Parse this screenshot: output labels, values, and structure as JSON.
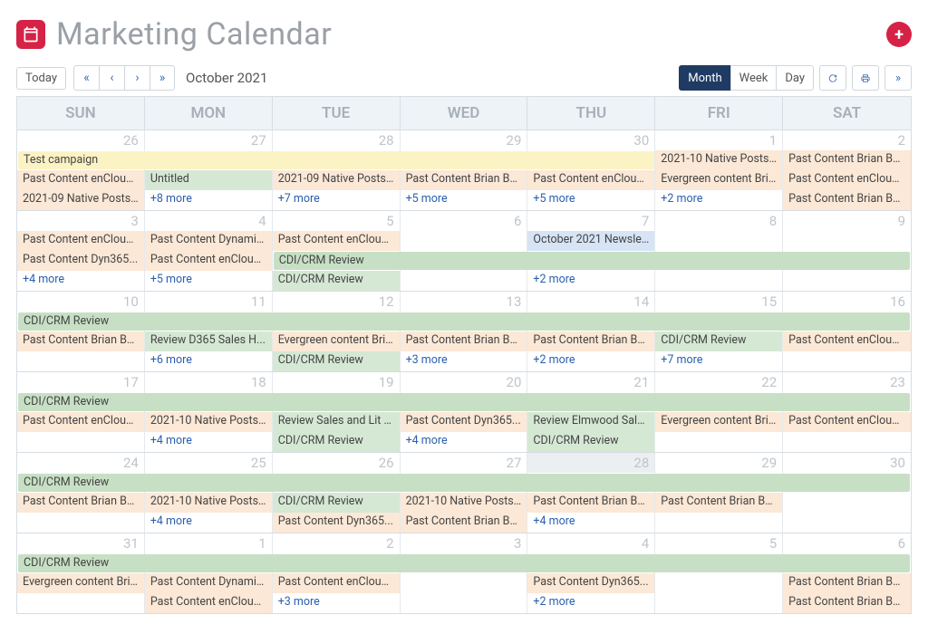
{
  "header": {
    "title": "Marketing Calendar"
  },
  "toolbar": {
    "today": "Today",
    "current_month": "October 2021",
    "views": {
      "month": "Month",
      "week": "Week",
      "day": "Day",
      "active": "month"
    }
  },
  "day_headers": [
    "SUN",
    "MON",
    "TUE",
    "WED",
    "THU",
    "FRI",
    "SAT"
  ],
  "weeks": [
    {
      "dates": [
        {
          "n": "26"
        },
        {
          "n": "27"
        },
        {
          "n": "28"
        },
        {
          "n": "29"
        },
        {
          "n": "30"
        },
        {
          "n": "1"
        },
        {
          "n": "2"
        }
      ],
      "spans": [
        {
          "row": 0,
          "start": 0,
          "end": 4,
          "cls": "c-yellow",
          "label": "Test campaign"
        }
      ],
      "cells": [
        [
          null,
          null,
          null,
          null,
          null,
          {
            "cls": "c-orange",
            "label": "2021-10 Native Posts ..."
          },
          {
            "cls": "c-orange",
            "label": "Past Content Brian Be..."
          }
        ],
        [
          {
            "cls": "c-orange",
            "label": "Past Content enCloud..."
          },
          {
            "cls": "c-green",
            "label": "Untitled"
          },
          {
            "cls": "c-orange",
            "label": "2021-09 Native Posts ..."
          },
          {
            "cls": "c-orange",
            "label": "Past Content Brian Be..."
          },
          {
            "cls": "c-orange",
            "label": "Past Content enCloud..."
          },
          {
            "cls": "c-orange",
            "label": "Evergreen content Bri..."
          },
          {
            "cls": "c-orange",
            "label": "Past Content enCloud..."
          }
        ],
        [
          {
            "cls": "c-orange",
            "label": "2021-09 Native Posts ..."
          },
          {
            "cls": "more",
            "label": "+8 more"
          },
          {
            "cls": "more",
            "label": "+7 more"
          },
          {
            "cls": "more",
            "label": "+5 more"
          },
          {
            "cls": "more",
            "label": "+5 more"
          },
          {
            "cls": "more",
            "label": "+2 more"
          },
          {
            "cls": "c-orange",
            "label": "Past Content Brian Be..."
          }
        ]
      ]
    },
    {
      "dates": [
        {
          "n": "3"
        },
        {
          "n": "4"
        },
        {
          "n": "5"
        },
        {
          "n": "6"
        },
        {
          "n": "7"
        },
        {
          "n": "8"
        },
        {
          "n": "9"
        }
      ],
      "spans": [
        {
          "row": 1,
          "start": 2,
          "end": 6,
          "cls": "c-greenb",
          "label": "CDI/CRM Review"
        }
      ],
      "cells": [
        [
          {
            "cls": "c-orange",
            "label": "Past Content enCloud..."
          },
          {
            "cls": "c-orange",
            "label": "Past Content Dynamic..."
          },
          {
            "cls": "c-orange",
            "label": "Past Content enCloud..."
          },
          null,
          {
            "cls": "c-blue",
            "label": "October 2021 Newslet..."
          },
          null,
          null
        ],
        [
          {
            "cls": "c-orange",
            "label": "Past Content Dyn365..."
          },
          {
            "cls": "c-orange",
            "label": "Past Content enCloud..."
          },
          null,
          null,
          null,
          null,
          null
        ],
        [
          {
            "cls": "more",
            "label": "+4 more"
          },
          {
            "cls": "more",
            "label": "+5 more"
          },
          {
            "cls": "c-green",
            "label": "CDI/CRM Review"
          },
          null,
          {
            "cls": "more",
            "label": "+2 more"
          },
          null,
          null
        ]
      ]
    },
    {
      "dates": [
        {
          "n": "10"
        },
        {
          "n": "11"
        },
        {
          "n": "12"
        },
        {
          "n": "13"
        },
        {
          "n": "14"
        },
        {
          "n": "15"
        },
        {
          "n": "16"
        }
      ],
      "spans": [
        {
          "row": 0,
          "start": 0,
          "end": 6,
          "cls": "c-greenb",
          "label": "CDI/CRM Review"
        }
      ],
      "cells": [
        [
          null,
          null,
          null,
          null,
          null,
          null,
          null
        ],
        [
          {
            "cls": "c-orange",
            "label": "Past Content Brian Be..."
          },
          {
            "cls": "c-green",
            "label": "Review D365 Sales H..."
          },
          {
            "cls": "c-orange",
            "label": "Evergreen content Bri..."
          },
          {
            "cls": "c-orange",
            "label": "Past Content Brian Be..."
          },
          {
            "cls": "c-orange",
            "label": "Past Content Brian Be..."
          },
          {
            "cls": "c-green",
            "label": "CDI/CRM Review"
          },
          {
            "cls": "c-orange",
            "label": "Past Content enCloud..."
          }
        ],
        [
          null,
          {
            "cls": "more",
            "label": "+6 more"
          },
          {
            "cls": "c-green",
            "label": "CDI/CRM Review"
          },
          {
            "cls": "more",
            "label": "+3 more"
          },
          {
            "cls": "more",
            "label": "+2 more"
          },
          {
            "cls": "more",
            "label": "+7 more"
          },
          null
        ]
      ]
    },
    {
      "dates": [
        {
          "n": "17"
        },
        {
          "n": "18"
        },
        {
          "n": "19"
        },
        {
          "n": "20"
        },
        {
          "n": "21"
        },
        {
          "n": "22"
        },
        {
          "n": "23"
        }
      ],
      "spans": [
        {
          "row": 0,
          "start": 0,
          "end": 6,
          "cls": "c-greenb",
          "label": "CDI/CRM Review"
        }
      ],
      "cells": [
        [
          null,
          null,
          null,
          null,
          null,
          null,
          null
        ],
        [
          {
            "cls": "c-orange",
            "label": "Past Content enCloud..."
          },
          {
            "cls": "c-orange",
            "label": "2021-10 Native Posts ..."
          },
          {
            "cls": "c-green",
            "label": "Review Sales and Lit p..."
          },
          {
            "cls": "c-orange",
            "label": "Past Content Dyn365..."
          },
          {
            "cls": "c-green",
            "label": "Review Elmwood Sale..."
          },
          {
            "cls": "c-orange",
            "label": "Evergreen content Bri..."
          },
          {
            "cls": "c-orange",
            "label": "Past Content enCloud..."
          }
        ],
        [
          null,
          {
            "cls": "more",
            "label": "+4 more"
          },
          {
            "cls": "c-green",
            "label": "CDI/CRM Review"
          },
          {
            "cls": "more",
            "label": "+4 more"
          },
          {
            "cls": "c-green",
            "label": "CDI/CRM Review"
          },
          null,
          null
        ]
      ]
    },
    {
      "dates": [
        {
          "n": "24"
        },
        {
          "n": "25"
        },
        {
          "n": "26"
        },
        {
          "n": "27"
        },
        {
          "n": "28",
          "today": true
        },
        {
          "n": "29"
        },
        {
          "n": "30"
        }
      ],
      "spans": [
        {
          "row": 0,
          "start": 0,
          "end": 6,
          "cls": "c-greenb",
          "label": "CDI/CRM Review"
        }
      ],
      "cells": [
        [
          null,
          null,
          null,
          null,
          null,
          null,
          null
        ],
        [
          {
            "cls": "c-orange",
            "label": "Past Content Brian Be..."
          },
          {
            "cls": "c-orange",
            "label": "2021-10 Native Posts ..."
          },
          {
            "cls": "c-green",
            "label": "CDI/CRM Review"
          },
          {
            "cls": "c-orange",
            "label": "2021-10 Native Posts ..."
          },
          {
            "cls": "c-orange",
            "label": "Past Content Brian Be..."
          },
          {
            "cls": "c-orange",
            "label": "Past Content Brian Be..."
          },
          null
        ],
        [
          null,
          {
            "cls": "more",
            "label": "+4 more"
          },
          {
            "cls": "c-orange",
            "label": "Past Content Dyn365..."
          },
          {
            "cls": "c-orange",
            "label": "Past Content Brian Be..."
          },
          {
            "cls": "more",
            "label": "+4 more"
          },
          null,
          null
        ]
      ]
    },
    {
      "dates": [
        {
          "n": "31"
        },
        {
          "n": "1"
        },
        {
          "n": "2"
        },
        {
          "n": "3"
        },
        {
          "n": "4"
        },
        {
          "n": "5"
        },
        {
          "n": "6"
        }
      ],
      "spans": [
        {
          "row": 0,
          "start": 0,
          "end": 6,
          "cls": "c-greenb",
          "label": "CDI/CRM Review"
        }
      ],
      "cells": [
        [
          null,
          null,
          null,
          null,
          null,
          null,
          null
        ],
        [
          {
            "cls": "c-orange",
            "label": "Evergreen content Bri..."
          },
          {
            "cls": "c-orange",
            "label": "Past Content Dynamic..."
          },
          {
            "cls": "c-orange",
            "label": "Past Content enCloud..."
          },
          null,
          {
            "cls": "c-orange",
            "label": "Past Content Dyn365..."
          },
          null,
          {
            "cls": "c-orange",
            "label": "Past Content Brian Be..."
          }
        ],
        [
          null,
          {
            "cls": "c-orange",
            "label": "Past Content enCloud..."
          },
          {
            "cls": "more",
            "label": "+3 more"
          },
          null,
          {
            "cls": "more",
            "label": "+2 more"
          },
          null,
          {
            "cls": "c-orange",
            "label": "Past Content Brian Be..."
          }
        ]
      ]
    }
  ]
}
